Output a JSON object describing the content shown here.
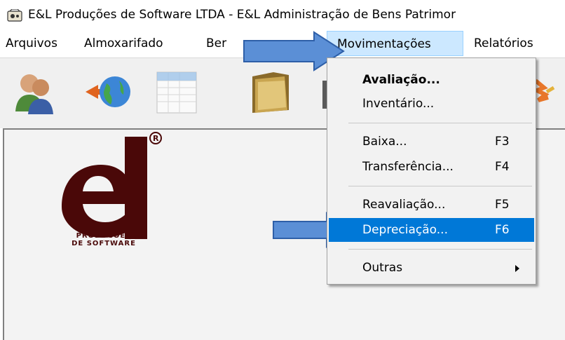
{
  "window": {
    "title": "E&L Produções de Software LTDA - E&L Administração de Bens Patrimor",
    "icon": "app-icon"
  },
  "menubar": {
    "items": [
      {
        "label": "Arquivos"
      },
      {
        "label": "Almoxarifado"
      },
      {
        "label": "Ber"
      },
      {
        "label": "Movimentações",
        "active": true
      },
      {
        "label": "Relatórios"
      }
    ]
  },
  "toolbar": {
    "buttons": [
      {
        "icon": "users-icon"
      },
      {
        "icon": "globe-arrow-icon"
      },
      {
        "icon": "spreadsheet-icon"
      },
      {
        "icon": "folder-icon"
      },
      {
        "icon": "partial-icon"
      },
      {
        "icon": "star-icon"
      }
    ]
  },
  "logo": {
    "text": "el",
    "registered": "®",
    "caption_line1": "PRODUCÕES",
    "caption_line2": "DE SOFTWARE"
  },
  "dropdown": {
    "items": [
      {
        "label": "Avaliação...",
        "shortcut": "",
        "bold": true
      },
      {
        "label": "Inventário...",
        "shortcut": ""
      },
      {
        "label": "Baixa...",
        "shortcut": "F3"
      },
      {
        "label": "Transferência...",
        "shortcut": "F4"
      },
      {
        "label": "Reavaliação...",
        "shortcut": "F5"
      },
      {
        "label": "Depreciação...",
        "shortcut": "F6",
        "selected": true
      },
      {
        "label": "Outras",
        "shortcut": "",
        "submenu": true
      }
    ]
  },
  "colors": {
    "selection": "#0078d7",
    "menu_active": "#cce8ff",
    "arrow_fill": "#5b8fd6",
    "logo": "#4a0808"
  }
}
